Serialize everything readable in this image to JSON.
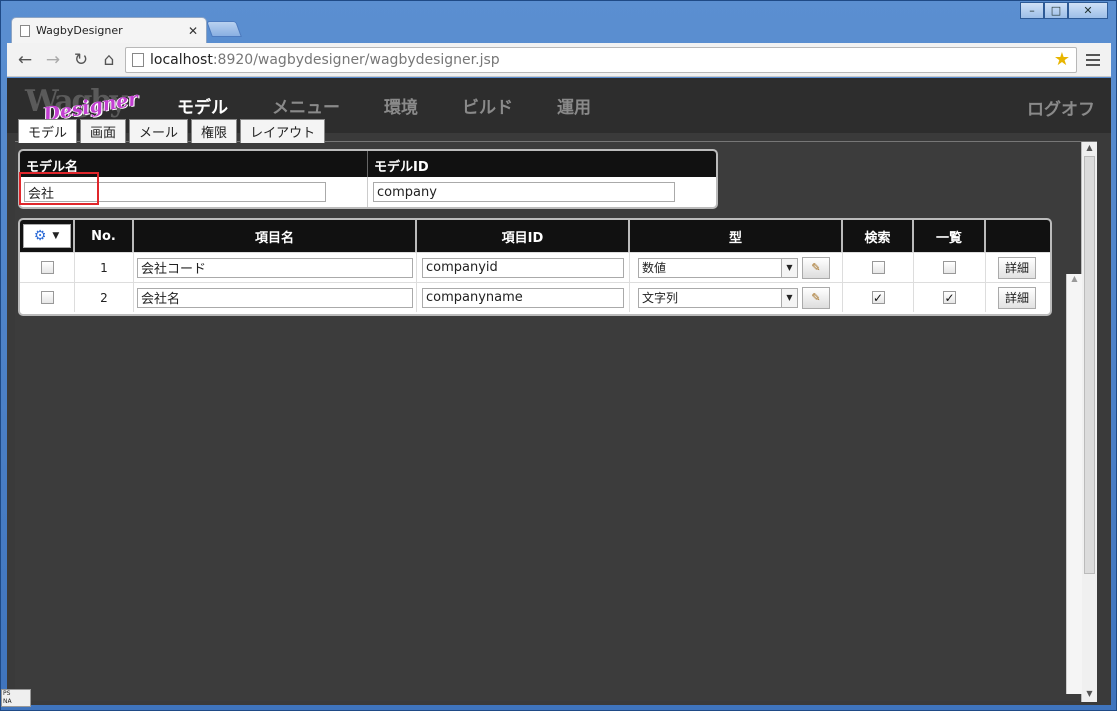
{
  "browser": {
    "tab_title": "WagbyDesigner",
    "url_host": "localhost",
    "url_rest": ":8920/wagbydesigner/wagbydesigner.jsp"
  },
  "app": {
    "logo_main": "Wagby",
    "logo_sub": "Designer",
    "nav": [
      "モデル",
      "メニュー",
      "環境",
      "ビルド",
      "運用"
    ],
    "logoff": "ログオフ"
  },
  "subtabs": [
    "モデル",
    "画面",
    "メール",
    "権限",
    "レイアウト"
  ],
  "model": {
    "name_header": "モデル名",
    "id_header": "モデルID",
    "name_value": "会社",
    "id_value": "company"
  },
  "grid": {
    "headers": {
      "no": "No.",
      "name": "項目名",
      "id": "項目ID",
      "type": "型",
      "search": "検索",
      "list": "一覧"
    },
    "rows": [
      {
        "no": "1",
        "name": "会社コード",
        "id": "companyid",
        "type": "数値",
        "search": false,
        "list": false,
        "detail": "詳細"
      },
      {
        "no": "2",
        "name": "会社名",
        "id": "companyname",
        "type": "文字列",
        "search": true,
        "list": true,
        "detail": "詳細"
      }
    ]
  },
  "status": {
    "line1": "PS",
    "line2": "NA"
  }
}
